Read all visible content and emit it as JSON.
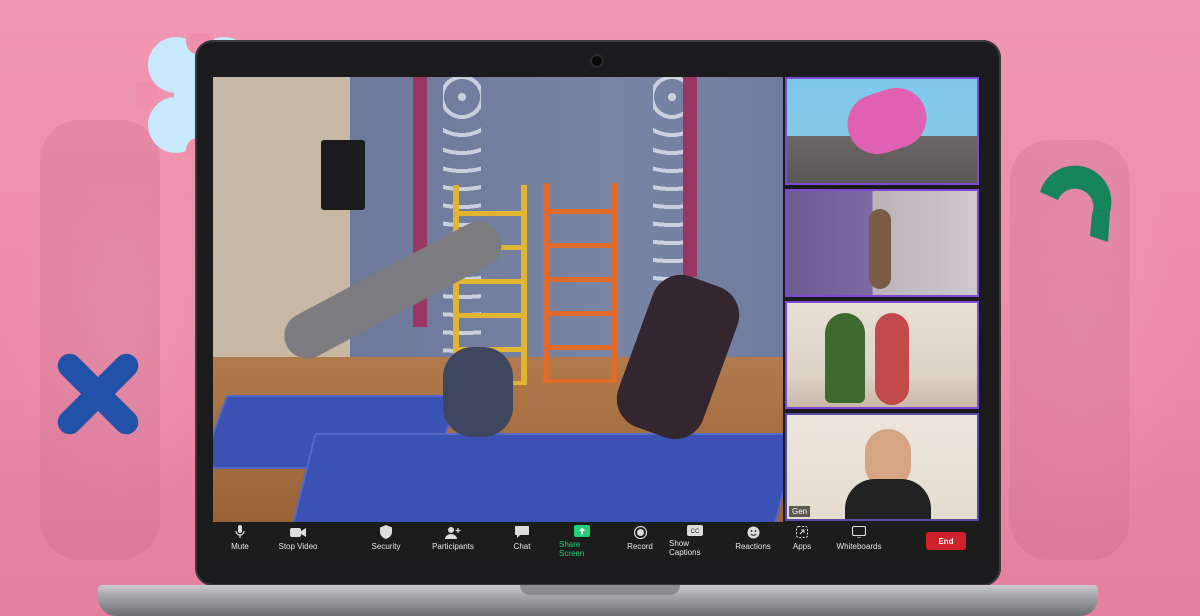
{
  "toolbar": {
    "mute_label": "Mute",
    "stop_video_label": "Stop Video",
    "security_label": "Security",
    "participants_label": "Participants",
    "chat_label": "Chat",
    "share_screen_label": "Share Screen",
    "record_label": "Record",
    "show_captions_label": "Show Captions",
    "reactions_label": "Reactions",
    "apps_label": "Apps",
    "whiteboards_label": "Whiteboards",
    "end_label": "End"
  },
  "participants": {
    "tile4_name": "Gen"
  },
  "colors": {
    "background_pink": "#ee8fac",
    "share_green": "#21d07a",
    "end_red": "#d0202a",
    "active_tile_border": "#7b4ad8",
    "deco_blue_light": "#c8e8fb",
    "deco_blue_dark": "#2251a8",
    "deco_green": "#16855a"
  },
  "icons": [
    "microphone-icon",
    "video-camera-icon",
    "shield-icon",
    "participants-icon",
    "chat-bubble-icon",
    "share-arrow-icon",
    "record-icon",
    "captions-icon",
    "reactions-icon",
    "apps-icon",
    "whiteboard-icon"
  ]
}
